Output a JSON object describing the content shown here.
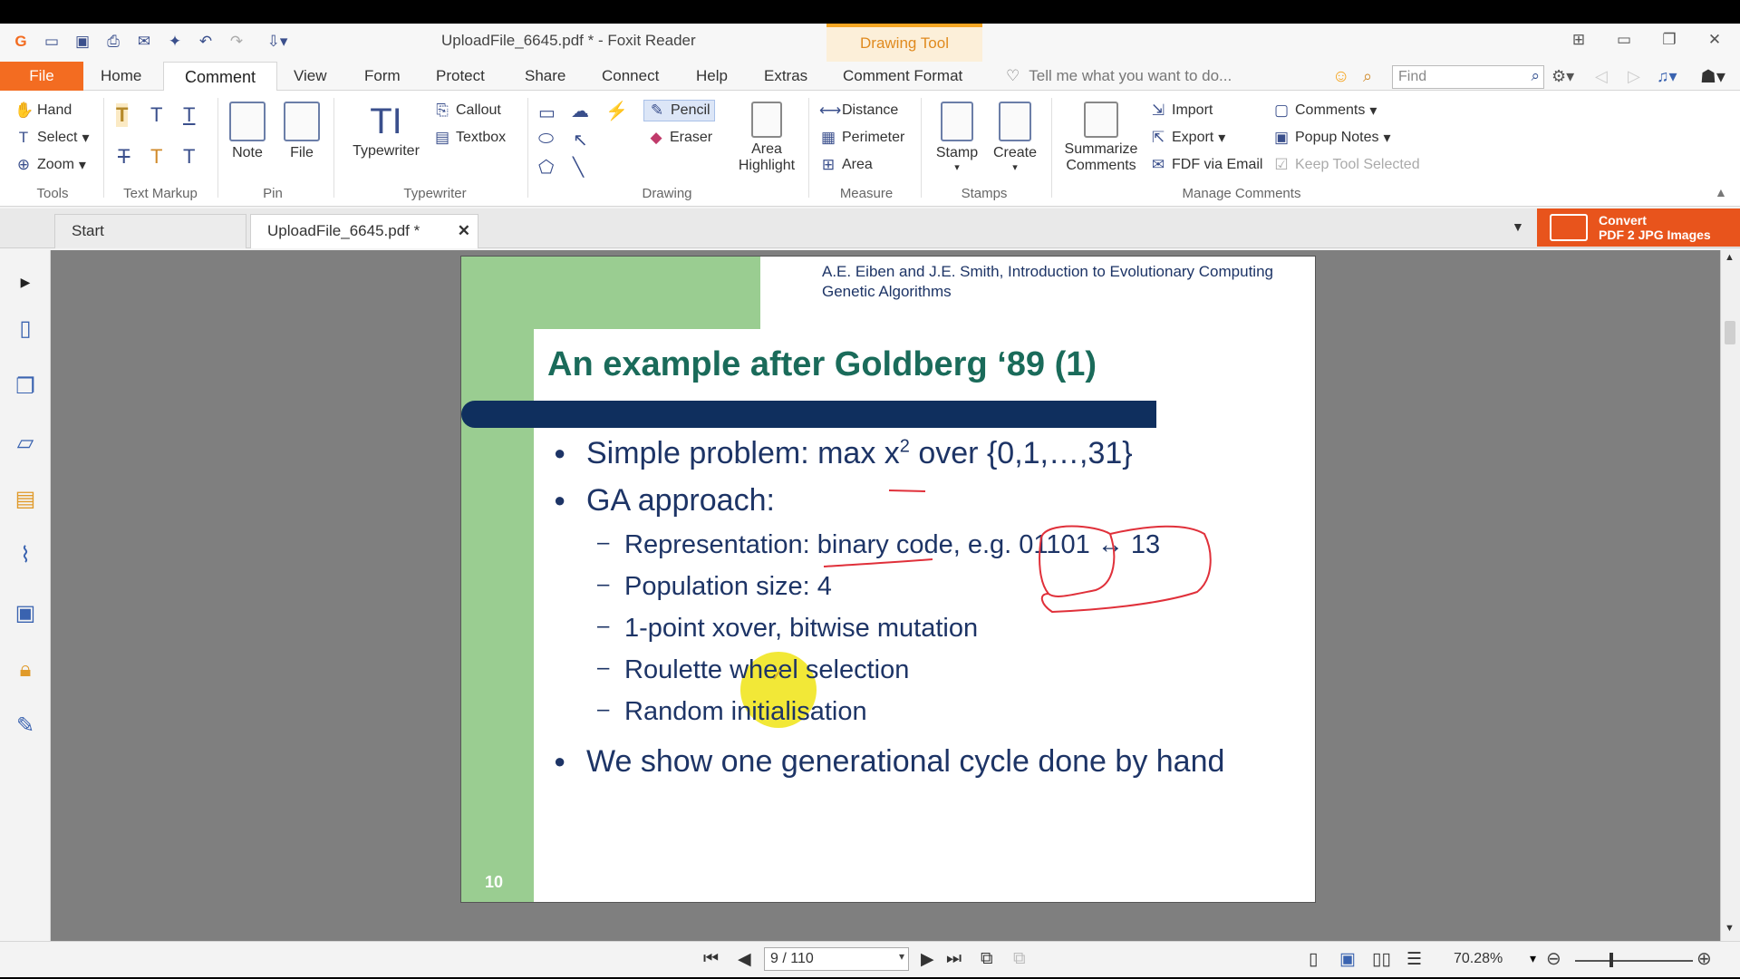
{
  "window": {
    "title": "UploadFile_6645.pdf * - Foxit Reader",
    "context_tab": "Drawing Tool"
  },
  "menu": {
    "file": "File",
    "tabs": [
      "Home",
      "Comment",
      "View",
      "Form",
      "Protect",
      "Share",
      "Connect",
      "Help",
      "Extras",
      "Comment Format"
    ],
    "tell_me": "Tell me what you want to do...",
    "find_placeholder": "Find"
  },
  "ribbon": {
    "tools": {
      "hand": "Hand",
      "select": "Select",
      "zoom": "Zoom",
      "label": "Tools"
    },
    "text_markup": {
      "label": "Text Markup"
    },
    "pin": {
      "note": "Note",
      "file": "File",
      "label": "Pin"
    },
    "typewriter": {
      "typewriter": "Typewriter",
      "callout": "Callout",
      "textbox": "Textbox",
      "label": "Typewriter"
    },
    "drawing": {
      "pencil": "Pencil",
      "eraser": "Eraser",
      "area_highlight_1": "Area",
      "area_highlight_2": "Highlight",
      "label": "Drawing"
    },
    "measure": {
      "distance": "Distance",
      "perimeter": "Perimeter",
      "area": "Area",
      "label": "Measure"
    },
    "stamps": {
      "stamp": "Stamp",
      "create": "Create",
      "label": "Stamps"
    },
    "manage": {
      "summarize_1": "Summarize",
      "summarize_2": "Comments",
      "import": "Import",
      "export": "Export",
      "fdf": "FDF via Email",
      "comments": "Comments",
      "popup_notes": "Popup Notes",
      "keep_tool": "Keep Tool Selected",
      "label": "Manage Comments"
    }
  },
  "doc_tabs": {
    "start": "Start",
    "file": "UploadFile_6645.pdf *",
    "convert_1": "Convert",
    "convert_2": "PDF 2 JPG Images"
  },
  "slide": {
    "authors_1": "A.E. Eiben and J.E. Smith, Introduction to Evolutionary Computing",
    "authors_2": "Genetic Algorithms",
    "title": "An example after Goldberg ‘89 (1)",
    "b1_text": "Simple problem: max x",
    "b1_sup": "2",
    "b1_rest": " over {0,1,…,31}",
    "b2": "GA approach:",
    "sub": [
      "Representation: binary code, e.g. 01101 ↔ 13",
      "Population size: 4",
      "1-point xover, bitwise mutation",
      "Roulette wheel selection",
      "Random initialisation"
    ],
    "b3": "We show one generational cycle done by hand",
    "page_number": "10"
  },
  "status": {
    "page_field": "9 / 110",
    "zoom": "70.28%"
  },
  "colors": {
    "accent": "#f36c21",
    "slide_green": "#9acd91",
    "title_teal": "#1a6b5a",
    "navy": "#0f2f5e",
    "annotation_red": "#e0303a"
  }
}
